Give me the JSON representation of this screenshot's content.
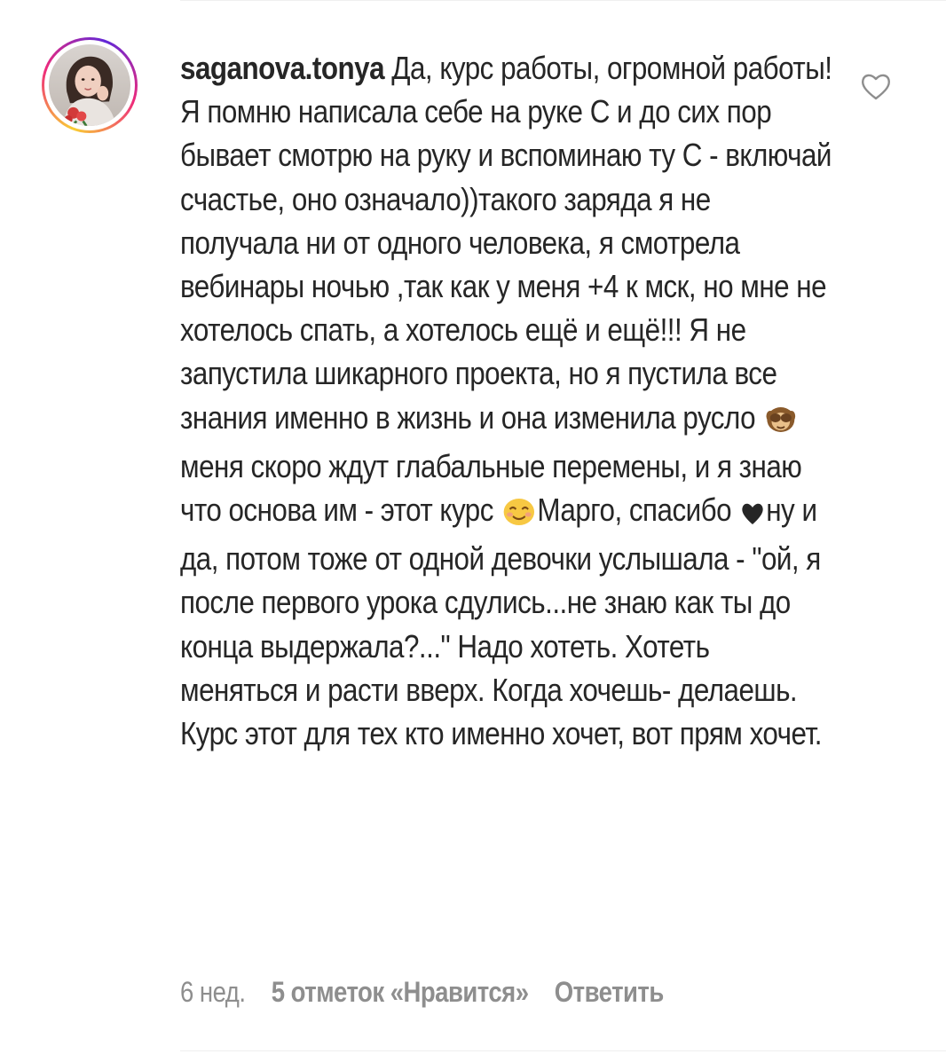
{
  "comment": {
    "username": "saganova.tonya",
    "text_segments": [
      "Да, курс работы, огромной работы! Я помню написала себе на руке С и до сих пор бывает смотрю на руку и вспоминаю ту С - включай счастье, оно означало))такого заряда я не получала ни от одного человека, я смотрела вебинары ночью ,так как у меня +4 к мск, но мне не хотелось спать, а хотелось ещё и ещё!!! Я не запустила шикарного проекта, но я пустила все знания именно в жизнь и она изменила русло ",
      "меня скоро ждут глабальные перемены, и я знаю что основа им - этот курс ",
      "Марго, спасибо ",
      "ну и да, потом тоже от одной девочки услышала - \"ой, я после первого урока сдулись...не знаю как ты до конца выдержала?...\" Надо хотеть. Хотеть меняться и расти вверх. Когда хочешь- делаешь. Курс этот для тех кто именно хочет, вот прям хочет."
    ],
    "emojis": [
      "see-no-evil-monkey-icon",
      "smiling-face-icon",
      "black-heart-icon"
    ],
    "time": "6 нед.",
    "likes": "5 отметок «Нравится»",
    "reply_label": "Ответить",
    "like_icon": "heart-outline-icon"
  },
  "colors": {
    "text": "#262626",
    "meta": "#8e8e8e",
    "divider": "#efefef"
  }
}
